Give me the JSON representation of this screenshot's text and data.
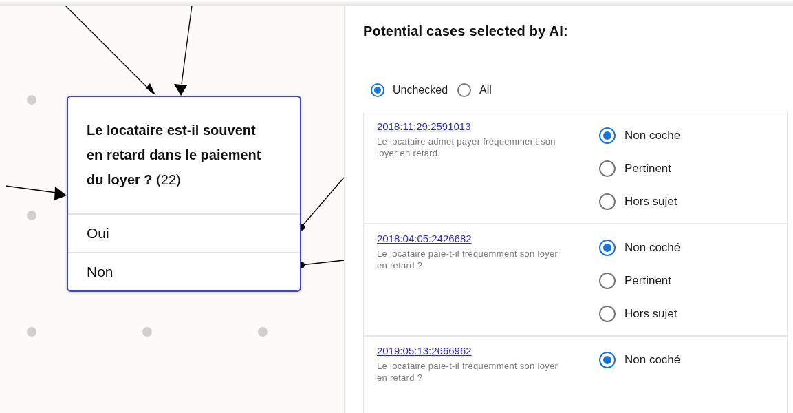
{
  "diagram": {
    "node": {
      "question": "**Le locataire est-il souvent en retard dans le paiement du loyer ?** (22)",
      "answers": [
        "Oui",
        "Non"
      ]
    }
  },
  "panel": {
    "title": "Potential cases selected by AI:",
    "filters": [
      {
        "label": "Unchecked",
        "selected": true
      },
      {
        "label": "All",
        "selected": false
      }
    ],
    "cases": [
      {
        "id": "2018:11:29:2591013",
        "text": "Le locataire admet payer fréquemment son loyer en retard.",
        "options": [
          {
            "label": "Non coché",
            "selected": true
          },
          {
            "label": "Pertinent",
            "selected": false
          },
          {
            "label": "Hors sujet",
            "selected": false
          }
        ]
      },
      {
        "id": "2018:04:05:2426682",
        "text": "Le locataire paie-t-il fréquemment son loyer en retard ?",
        "options": [
          {
            "label": "Non coché",
            "selected": true
          },
          {
            "label": "Pertinent",
            "selected": false
          },
          {
            "label": "Hors sujet",
            "selected": false
          }
        ]
      },
      {
        "id": "2019:05:13:2666962",
        "text": "Le locataire paie-t-il fréquemment son loyer en retard ?",
        "options": [
          {
            "label": "Non coché",
            "selected": true
          }
        ]
      }
    ]
  }
}
